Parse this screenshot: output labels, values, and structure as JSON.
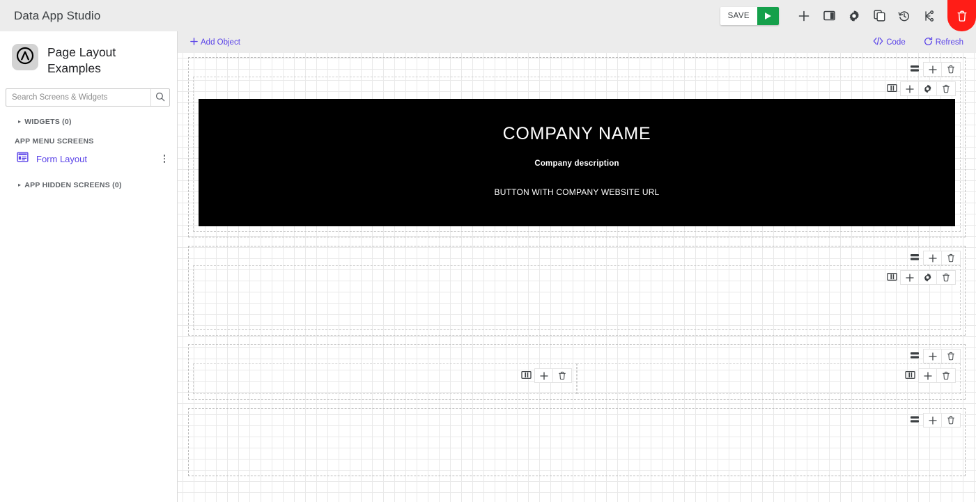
{
  "app": {
    "title": "Data App Studio"
  },
  "topbar": {
    "save_label": "SAVE",
    "actions": [
      {
        "name": "run-button",
        "icon": "play-icon"
      },
      {
        "name": "add-button",
        "icon": "plus-icon"
      },
      {
        "name": "panel-toggle-button",
        "icon": "panel-icon"
      },
      {
        "name": "settings-button",
        "icon": "gear-icon"
      },
      {
        "name": "duplicate-button",
        "icon": "copy-icon"
      },
      {
        "name": "history-button",
        "icon": "history-icon"
      },
      {
        "name": "branch-button",
        "icon": "branch-icon"
      },
      {
        "name": "delete-button",
        "icon": "trash-icon"
      }
    ],
    "delete_color": "#ff1d17",
    "play_color": "#15a04b"
  },
  "sidebar": {
    "logo_icon": "circle-caret-logo",
    "screen_title": "Page Layout Examples",
    "search": {
      "placeholder": "Search Screens & Widgets",
      "value": "",
      "icon": "search-icon"
    },
    "widgets_group": {
      "label": "WIDGETS (0)",
      "caret": "▸"
    },
    "app_menu_screens_label": "APP MENU SCREENS",
    "screens": [
      {
        "label": "Form Layout",
        "icon": "form-layout-icon",
        "color": "#5a43e8",
        "menu_icon": "kebab-icon"
      }
    ],
    "hidden_group": {
      "label": "APP HIDDEN SCREENS (0)",
      "caret": "▸"
    }
  },
  "canvas_toolbar": {
    "add_object_label": "Add Object",
    "add_object_icon": "plus-icon",
    "code_label": "Code",
    "code_icon": "code-icon",
    "refresh_label": "Refresh",
    "refresh_icon": "refresh-icon",
    "accent_color": "#5a43e8"
  },
  "canvas": {
    "row_tools": [
      {
        "name": "rows-icon",
        "interactable": true
      },
      {
        "name": "plus-icon",
        "interactable": true
      },
      {
        "name": "trash-icon",
        "interactable": true
      }
    ],
    "container_tools": [
      {
        "name": "columns-icon",
        "interactable": true
      },
      {
        "name": "plus-icon",
        "interactable": true
      },
      {
        "name": "gear-icon",
        "interactable": true
      },
      {
        "name": "trash-icon",
        "interactable": true
      }
    ],
    "column_tools": [
      {
        "name": "columns-icon",
        "interactable": true
      },
      {
        "name": "plus-icon",
        "interactable": true
      },
      {
        "name": "trash-icon",
        "interactable": true
      }
    ],
    "hero": {
      "title": "COMPANY NAME",
      "subtitle": "Company description",
      "button_label": "BUTTON WITH COMPANY WEBSITE URL",
      "background": "#000000",
      "text_color": "#ffffff"
    }
  }
}
